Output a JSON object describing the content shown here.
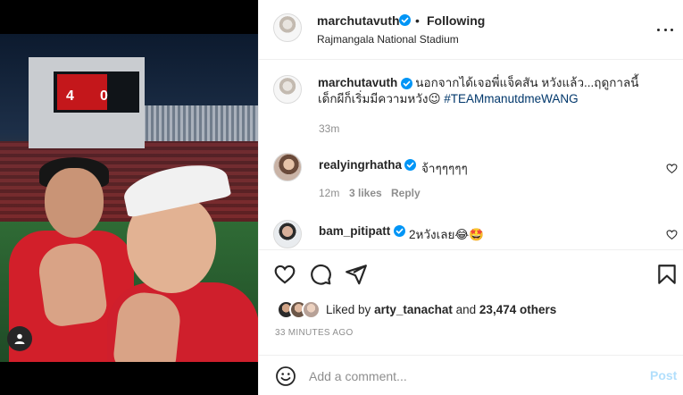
{
  "post": {
    "username": "marchutavuth",
    "follow_status": "Following",
    "separator": "•",
    "location": "Rajmangala National Stadium",
    "more_icon": "more-horizontal-icon"
  },
  "photo": {
    "scoreboard": {
      "home": "4",
      "away": "0"
    }
  },
  "caption": {
    "username": "marchutavuth",
    "text": "นอกจากได้เจอพี่แจ็คสัน หวังแล้ว...ฤดูกาลนี้เด็กผีก็เริ่มมีความหวัง😉 ",
    "hashtag": "#TEAMmanutdmeWANG",
    "time": "33m"
  },
  "comments": [
    {
      "username": "realyingrhatha",
      "text": "จ้าๆๆๆๆๆ",
      "time": "12m",
      "likes": "3 likes",
      "reply": "Reply"
    },
    {
      "username": "bam_pitipatt",
      "text": "2หวังเลย😂🤩"
    }
  ],
  "actions": [
    "heart-icon",
    "comment-icon",
    "share-icon",
    "bookmark-icon"
  ],
  "likes": {
    "prefix": "Liked by",
    "user": "arty_tanachat",
    "middle": "and",
    "count": "23,474 others"
  },
  "time_ago": "33 MINUTES AGO",
  "add_comment": {
    "placeholder": "Add a comment...",
    "post_label": "Post"
  },
  "colors": {
    "verified": "#0095f6",
    "hashtag": "#00376b",
    "post_disabled": "#b2dffc",
    "muted": "#8e8e8e"
  }
}
